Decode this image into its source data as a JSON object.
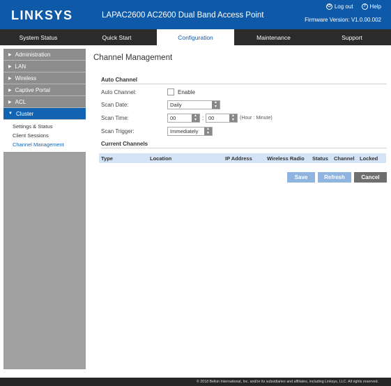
{
  "header": {
    "brand": "LINKSYS",
    "product_title": "LAPAC2600 AC2600 Dual Band Access Point",
    "logout_label": "Log out",
    "help_label": "Help",
    "firmware": "Firmware Version: V1.0.00.002"
  },
  "nav": {
    "tabs": [
      {
        "label": "System Status"
      },
      {
        "label": "Quick Start"
      },
      {
        "label": "Configuration"
      },
      {
        "label": "Maintenance"
      },
      {
        "label": "Support"
      }
    ],
    "active": "Configuration"
  },
  "sidebar": {
    "items": [
      {
        "label": "Administration"
      },
      {
        "label": "LAN"
      },
      {
        "label": "Wireless"
      },
      {
        "label": "Captive Portal"
      },
      {
        "label": "ACL"
      },
      {
        "label": "Cluster"
      }
    ],
    "subitems": [
      {
        "label": "Settings & Status"
      },
      {
        "label": "Client Sessions"
      },
      {
        "label": "Channel Management"
      }
    ]
  },
  "main": {
    "title": "Channel Management",
    "auto_channel_section": "Auto Channel",
    "auto_channel_label": "Auto Channel:",
    "enable_label": "Enable",
    "enable_checked": false,
    "scan_date_label": "Scan Date:",
    "scan_date_value": "Daily",
    "scan_time_label": "Scan Time:",
    "scan_hour_value": "00",
    "scan_minute_value": "00",
    "time_separator": ":",
    "time_hint": "(Hour : Minute)",
    "scan_trigger_label": "Scan Trigger:",
    "scan_trigger_value": "Immediately",
    "current_channels_section": "Current Channels",
    "table_headers": [
      "Type",
      "Location",
      "IP Address",
      "Wireless Radio",
      "Status",
      "Channel",
      "Locked"
    ],
    "save_label": "Save",
    "refresh_label": "Refresh",
    "cancel_label": "Cancel"
  },
  "footer": {
    "copyright": "© 2018 Belkin International, Inc. and/or its subsidiaries and affiliates, including Linksys, LLC. All rights reserved."
  },
  "colors": {
    "header_blue": "#0f5aa8",
    "nav_dark": "#2b2b2b",
    "sidebar_active": "#1363b3",
    "table_header": "#d4e3f5",
    "button_blue": "#8fb4e0",
    "button_cancel": "#6e6e6e"
  }
}
